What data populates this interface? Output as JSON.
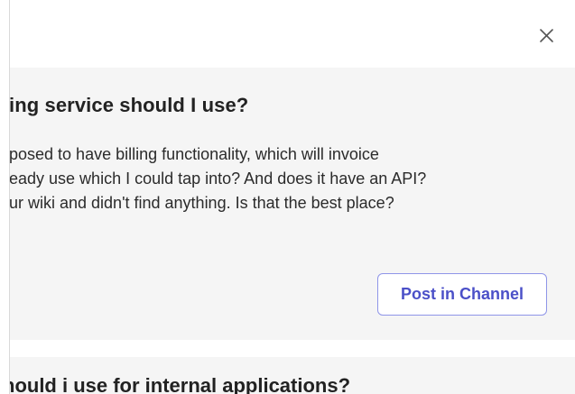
{
  "dialog": {
    "close_icon": "close-icon"
  },
  "question_card": {
    "title": "ing service should I use?",
    "body_lines": [
      "posed to have billing functionality, which will invoice",
      "eady use which I could tap into? And does it have an API?",
      "ur wiki and didn't find anything. Is that the best place?"
    ],
    "post_button_label": "Post in Channel"
  },
  "next_card": {
    "title": "hould i use for internal applications?"
  },
  "colors": {
    "card_background": "#f5f5f5",
    "button_border": "#8f95e8",
    "button_text": "#4b50c8",
    "title_text": "#222222"
  }
}
